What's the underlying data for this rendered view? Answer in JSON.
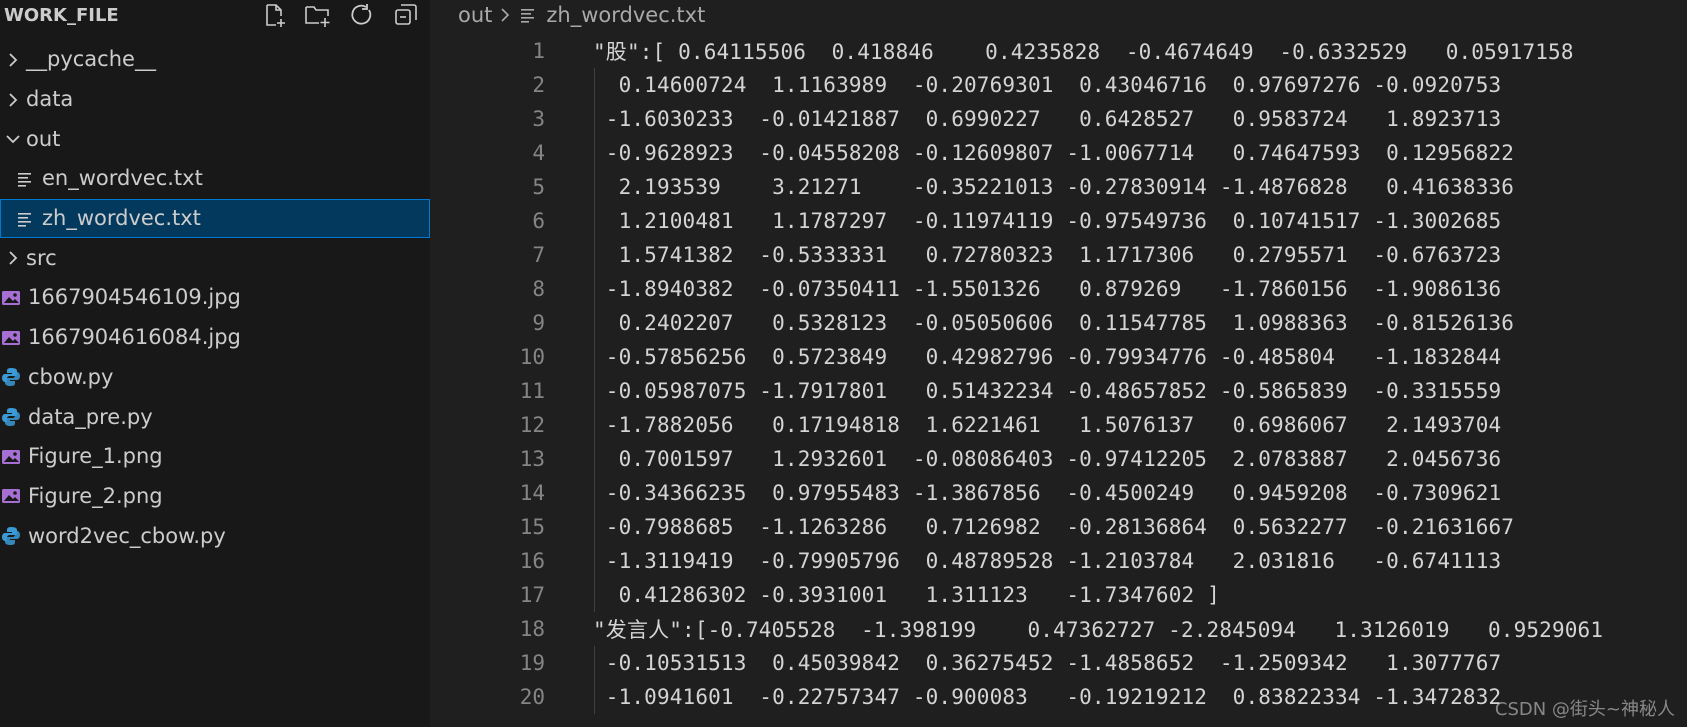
{
  "sidebar": {
    "title": "WORK_FILE",
    "actions": [
      {
        "name": "new-file-icon"
      },
      {
        "name": "new-folder-icon"
      },
      {
        "name": "refresh-icon"
      },
      {
        "name": "collapse-all-icon"
      }
    ],
    "tree": [
      {
        "label": "__pycache__",
        "type": "folder",
        "expanded": false
      },
      {
        "label": "data",
        "type": "folder",
        "expanded": false
      },
      {
        "label": "out",
        "type": "folder",
        "expanded": true
      },
      {
        "label": "en_wordvec.txt",
        "type": "text-file",
        "child": true
      },
      {
        "label": "zh_wordvec.txt",
        "type": "text-file",
        "child": true,
        "selected": true
      },
      {
        "label": "src",
        "type": "folder",
        "expanded": false
      },
      {
        "label": "1667904546109.jpg",
        "type": "image-file"
      },
      {
        "label": "1667904616084.jpg",
        "type": "image-file"
      },
      {
        "label": "cbow.py",
        "type": "python-file"
      },
      {
        "label": "data_pre.py",
        "type": "python-file"
      },
      {
        "label": "Figure_1.png",
        "type": "image-file"
      },
      {
        "label": "Figure_2.png",
        "type": "image-file"
      },
      {
        "label": "word2vec_cbow.py",
        "type": "python-file"
      }
    ]
  },
  "breadcrumb": {
    "folder": "out",
    "file": "zh_wordvec.txt"
  },
  "editor": {
    "lines": [
      {
        "n": "1",
        "text": "\"股\":[ 0.64115506  0.418846    0.4235828  -0.4674649  -0.6332529   0.05917158"
      },
      {
        "n": "2",
        "text": "  0.14600724  1.1163989  -0.20769301  0.43046716  0.97697276 -0.0920753"
      },
      {
        "n": "3",
        "text": " -1.6030233  -0.01421887  0.6990227   0.6428527   0.9583724   1.8923713"
      },
      {
        "n": "4",
        "text": " -0.9628923  -0.04558208 -0.12609807 -1.0067714   0.74647593  0.12956822"
      },
      {
        "n": "5",
        "text": "  2.193539    3.21271    -0.35221013 -0.27830914 -1.4876828   0.41638336"
      },
      {
        "n": "6",
        "text": "  1.2100481   1.1787297  -0.11974119 -0.97549736  0.10741517 -1.3002685"
      },
      {
        "n": "7",
        "text": "  1.5741382  -0.5333331   0.72780323  1.1717306   0.2795571  -0.6763723"
      },
      {
        "n": "8",
        "text": " -1.8940382  -0.07350411 -1.5501326   0.879269   -1.7860156  -1.9086136"
      },
      {
        "n": "9",
        "text": "  0.2402207   0.5328123  -0.05050606  0.11547785  1.0988363  -0.81526136"
      },
      {
        "n": "10",
        "text": " -0.57856256  0.5723849   0.42982796 -0.79934776 -0.485804   -1.1832844"
      },
      {
        "n": "11",
        "text": " -0.05987075 -1.7917801   0.51432234 -0.48657852 -0.5865839  -0.3315559"
      },
      {
        "n": "12",
        "text": " -1.7882056   0.17194818  1.6221461   1.5076137   0.6986067   2.1493704"
      },
      {
        "n": "13",
        "text": "  0.7001597   1.2932601  -0.08086403 -0.97412205  2.0783887   2.0456736"
      },
      {
        "n": "14",
        "text": " -0.34366235  0.97955483 -1.3867856  -0.4500249   0.9459208  -0.7309621"
      },
      {
        "n": "15",
        "text": " -0.7988685  -1.1263286   0.7126982  -0.28136864  0.5632277  -0.21631667"
      },
      {
        "n": "16",
        "text": " -1.3119419  -0.79905796  0.48789528 -1.2103784   2.031816   -0.6741113"
      },
      {
        "n": "17",
        "text": "  0.41286302 -0.3931001   1.311123   -1.7347602 ]"
      },
      {
        "n": "18",
        "text": "\"发言人\":[-0.7405528  -1.398199    0.47362727 -2.2845094   1.3126019   0.9529061"
      },
      {
        "n": "19",
        "text": " -0.10531513  0.45039842  0.36275452 -1.4858652  -1.2509342   1.3077767"
      },
      {
        "n": "20",
        "text": " -1.0941601  -0.22757347 -0.900083   -0.19219212  0.83822334 -1.3472832"
      }
    ]
  },
  "watermark": "CSDN @街头~神秘人",
  "colors": {
    "sidebar_bg": "#181818",
    "editor_bg": "#1f1f1f",
    "selection_bg": "#04395e",
    "selection_border": "#0078d4",
    "python_icon": "#3b9ad6",
    "image_icon": "#a66fd3"
  }
}
